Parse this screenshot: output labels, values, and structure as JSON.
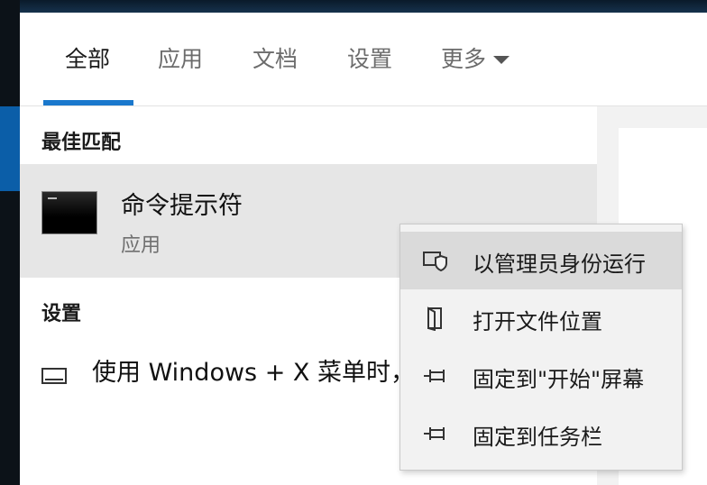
{
  "tabs": [
    {
      "label": "全部"
    },
    {
      "label": "应用"
    },
    {
      "label": "文档"
    },
    {
      "label": "设置"
    },
    {
      "label": "更多"
    }
  ],
  "best_match": {
    "section_title": "最佳匹配",
    "name": "命令提示符",
    "type": "应用"
  },
  "settings": {
    "section_title": "设置",
    "item_text": "使用 Windows + X 菜单时，将命令提示符替换为 Windows PowerShell"
  },
  "context_menu": {
    "items": [
      {
        "label": "以管理员身份运行",
        "icon": "shield-icon"
      },
      {
        "label": "打开文件位置",
        "icon": "file-location-icon"
      },
      {
        "label": "固定到\"开始\"屏幕",
        "icon": "pin-icon"
      },
      {
        "label": "固定到任务栏",
        "icon": "pin-icon"
      }
    ]
  },
  "colors": {
    "accent": "#1a78cc",
    "selected_row": "#e6e6e6",
    "menu_bg": "#f2f2f2",
    "menu_highlight": "#dadada"
  }
}
